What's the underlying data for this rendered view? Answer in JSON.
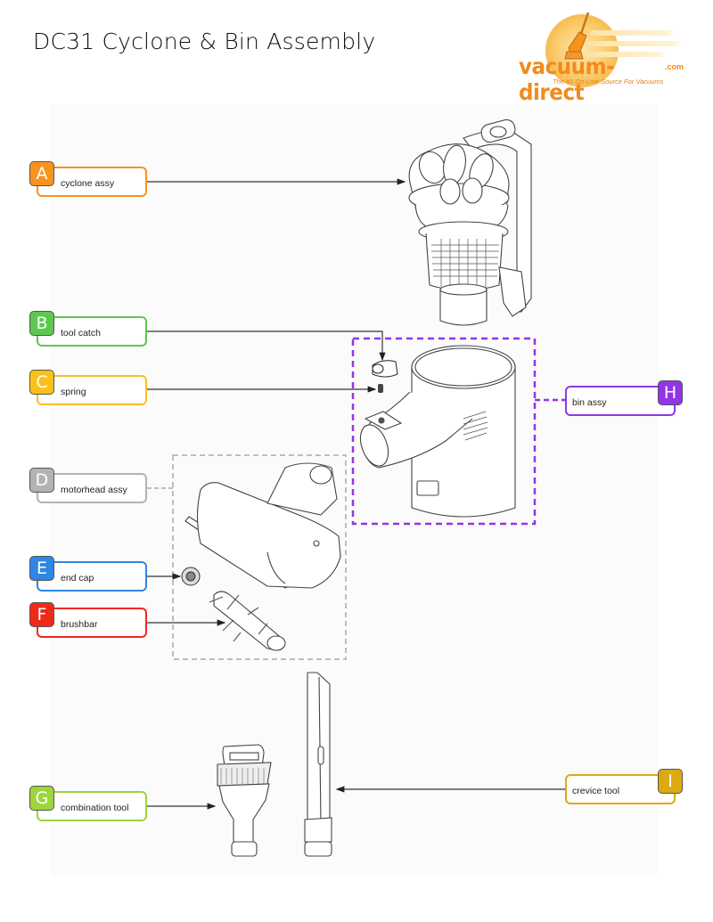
{
  "title": "DC31 Cyclone & Bin Assembly",
  "logo": {
    "brand": "vacuum-direct",
    "tld": ".com",
    "tagline": "The #1 On-Line Source For Vacuums",
    "color": "#f38a1c"
  },
  "callouts": [
    {
      "letter": "A",
      "label": "cyclone assy",
      "color": "#f7941d"
    },
    {
      "letter": "B",
      "label": "tool catch",
      "color": "#5cc84e"
    },
    {
      "letter": "C",
      "label": "spring",
      "color": "#f9c11a"
    },
    {
      "letter": "D",
      "label": "motorhead assy",
      "color": "#b3b3b3"
    },
    {
      "letter": "E",
      "label": "end cap",
      "color": "#2e86e6"
    },
    {
      "letter": "F",
      "label": "brushbar",
      "color": "#ee2a1b"
    },
    {
      "letter": "G",
      "label": "combination tool",
      "color": "#9ed43c"
    },
    {
      "letter": "H",
      "label": "bin assy",
      "color": "#9235e8"
    },
    {
      "letter": "I",
      "label": "crevice tool",
      "color": "#dcaa10"
    }
  ],
  "groups": {
    "bin_assy_color": "#9235e8",
    "motorhead_assy_color": "#bdbdbd"
  },
  "parts": [
    "cyclone-assembly",
    "tool-catch",
    "spring",
    "bin-assembly",
    "motorhead",
    "end-cap",
    "brushbar",
    "combination-tool",
    "crevice-tool"
  ]
}
